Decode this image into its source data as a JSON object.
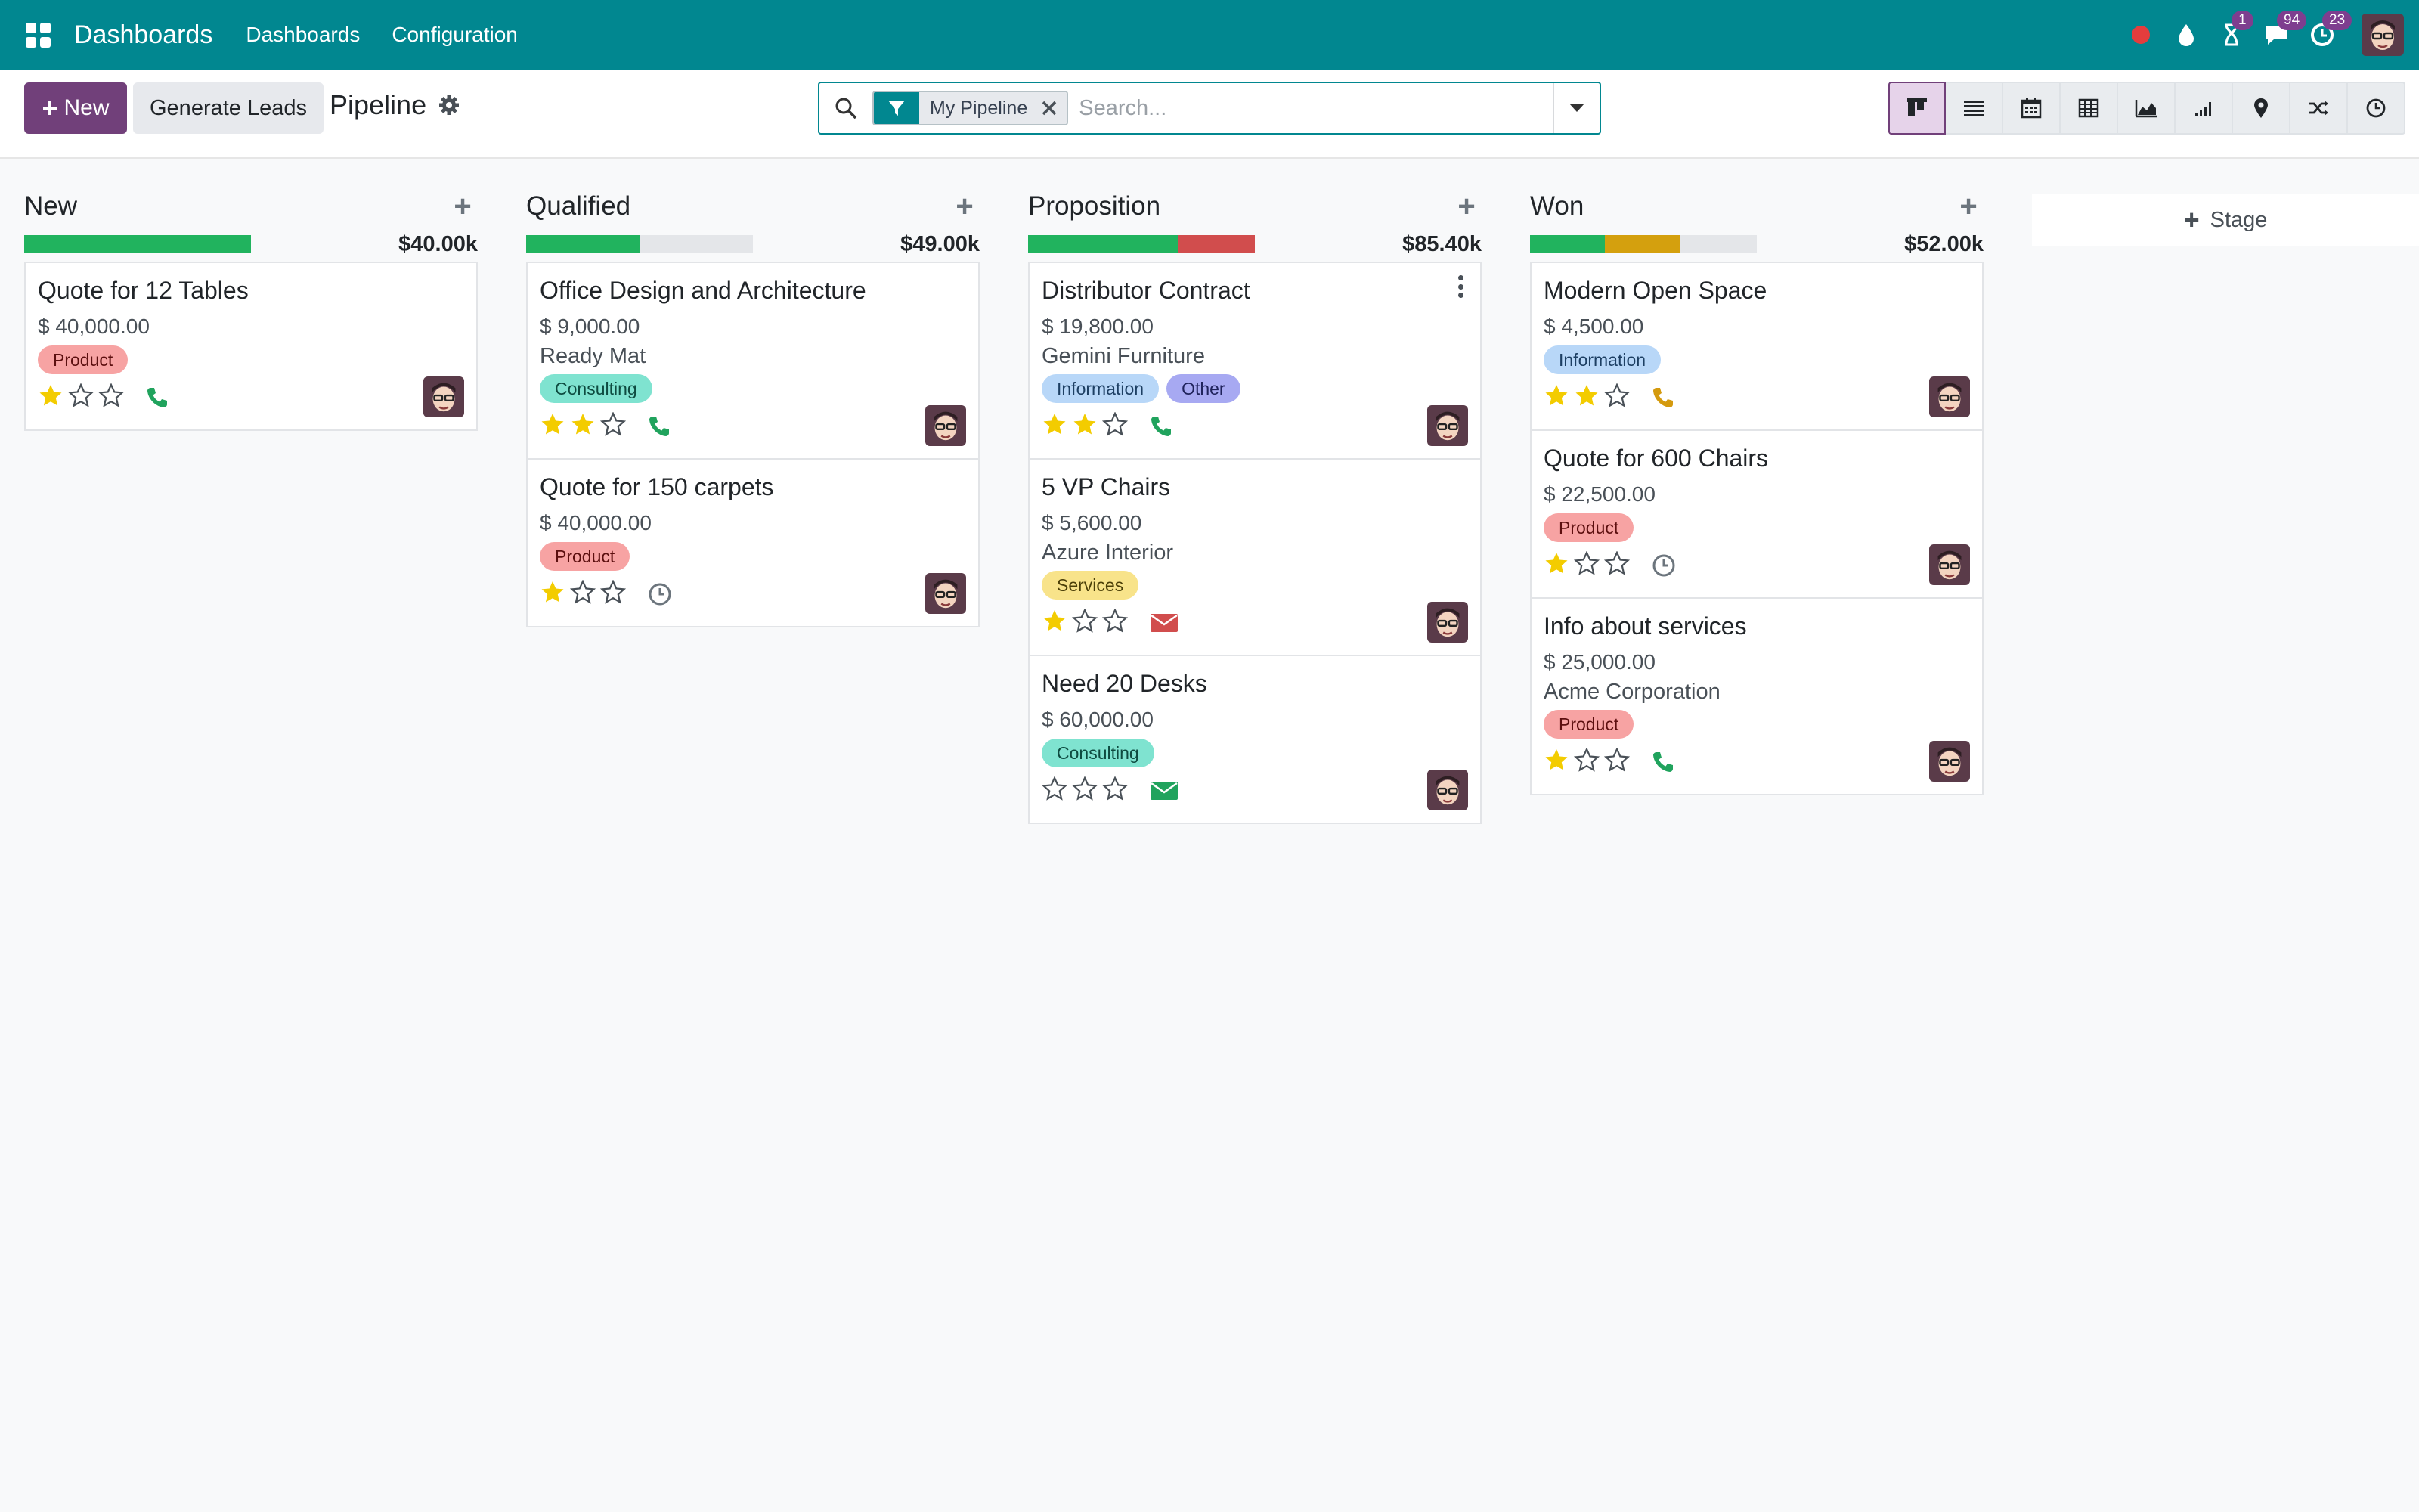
{
  "navbar": {
    "brand": "Dashboards",
    "menus": [
      "Dashboards",
      "Configuration"
    ],
    "badges": {
      "activity": "1",
      "messages": "94",
      "updates": "23"
    },
    "bg_color": "#018790"
  },
  "control": {
    "new_label": "New",
    "generate_label": "Generate Leads",
    "breadcrumb": "Pipeline",
    "facet_label": "My Pipeline",
    "search_placeholder": "Search...",
    "views": [
      "kanban-icon",
      "list-icon",
      "calendar-icon",
      "pivot-icon",
      "graph-icon",
      "cohort-icon",
      "map-icon",
      "cohort-shuffle-icon",
      "activity-icon"
    ]
  },
  "columns": [
    {
      "title": "New",
      "sum": "$40.00k",
      "progress": [
        {
          "color": "#21b35e",
          "pct": 100
        }
      ],
      "cards": [
        {
          "title": "Quote for 12 Tables",
          "amount": "$ 40,000.00",
          "company": "",
          "tags": [
            {
              "label": "Product",
              "bg": "#f7a3a3",
              "fg": "#5c0f0f"
            }
          ],
          "stars": 1,
          "activity": "phone",
          "activity_color": "#20a35d"
        }
      ]
    },
    {
      "title": "Qualified",
      "sum": "$49.00k",
      "progress": [
        {
          "color": "#21b35e",
          "pct": 50
        }
      ],
      "cards": [
        {
          "title": "Office Design and Architecture",
          "amount": "$ 9,000.00",
          "company": "Ready Mat",
          "tags": [
            {
              "label": "Consulting",
              "bg": "#7fe3d0",
              "fg": "#0e4b40"
            }
          ],
          "stars": 2,
          "activity": "phone",
          "activity_color": "#20a35d"
        },
        {
          "title": "Quote for 150 carpets",
          "amount": "$ 40,000.00",
          "company": "",
          "tags": [
            {
              "label": "Product",
              "bg": "#f7a3a3",
              "fg": "#5c0f0f"
            }
          ],
          "stars": 1,
          "activity": "clock",
          "activity_color": "#6c757d"
        }
      ]
    },
    {
      "title": "Proposition",
      "sum": "$85.40k",
      "progress": [
        {
          "color": "#21b35e",
          "pct": 66
        },
        {
          "color": "#d14d4d",
          "pct": 34
        }
      ],
      "cards": [
        {
          "title": "Distributor Contract",
          "amount": "$ 19,800.00",
          "company": "Gemini Furniture",
          "tags": [
            {
              "label": "Information",
              "bg": "#b8d7f8",
              "fg": "#1d3f63"
            },
            {
              "label": "Other",
              "bg": "#a7a9f2",
              "fg": "#20235c"
            }
          ],
          "stars": 2,
          "activity": "phone",
          "activity_color": "#20a35d",
          "menu": true
        },
        {
          "title": "5 VP Chairs",
          "amount": "$ 5,600.00",
          "company": "Azure Interior",
          "tags": [
            {
              "label": "Services",
              "bg": "#f8e38a",
              "fg": "#4b3f08"
            }
          ],
          "stars": 1,
          "activity": "mail",
          "activity_color": "#d14d4d"
        },
        {
          "title": "Need 20 Desks",
          "amount": "$ 60,000.00",
          "company": "",
          "tags": [
            {
              "label": "Consulting",
              "bg": "#7fe3d0",
              "fg": "#0e4b40"
            }
          ],
          "stars": 0,
          "activity": "mail",
          "activity_color": "#20a35d"
        }
      ]
    },
    {
      "title": "Won",
      "sum": "$52.00k",
      "progress": [
        {
          "color": "#21b35e",
          "pct": 33
        },
        {
          "color": "#d4a00e",
          "pct": 33
        }
      ],
      "cards": [
        {
          "title": "Modern Open Space",
          "amount": "$ 4,500.00",
          "company": "",
          "tags": [
            {
              "label": "Information",
              "bg": "#b8d7f8",
              "fg": "#1d3f63"
            }
          ],
          "stars": 2,
          "activity": "phone",
          "activity_color": "#d49a0e"
        },
        {
          "title": "Quote for 600 Chairs",
          "amount": "$ 22,500.00",
          "company": "",
          "tags": [
            {
              "label": "Product",
              "bg": "#f7a3a3",
              "fg": "#5c0f0f"
            }
          ],
          "stars": 1,
          "activity": "clock",
          "activity_color": "#6c757d"
        },
        {
          "title": "Info about services",
          "amount": "$ 25,000.00",
          "company": "Acme Corporation",
          "tags": [
            {
              "label": "Product",
              "bg": "#f7a3a3",
              "fg": "#5c0f0f"
            }
          ],
          "stars": 1,
          "activity": "phone",
          "activity_color": "#20a35d"
        }
      ]
    }
  ],
  "add_stage_label": "Stage"
}
